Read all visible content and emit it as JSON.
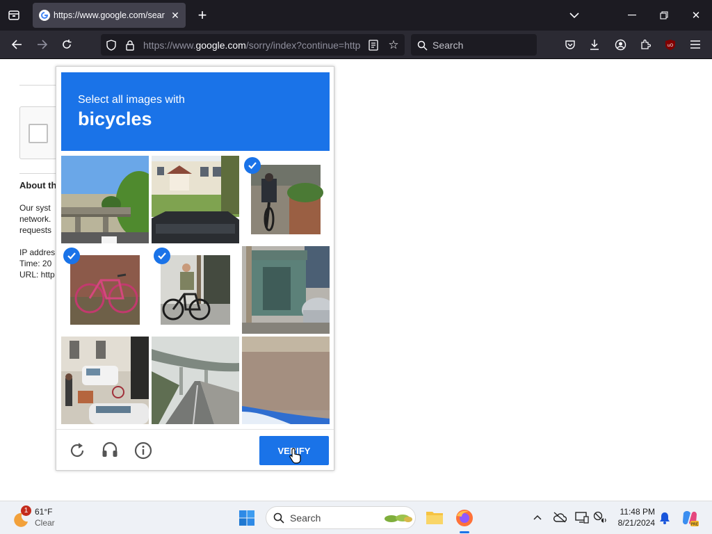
{
  "browser": {
    "tab_title": "https://www.google.com/sear",
    "url_prefix": "https://www.",
    "url_domain": "google.com",
    "url_rest": "/sorry/index?continue=http",
    "search_placeholder": "Search"
  },
  "page": {
    "about_heading": "About th",
    "body_lines": [
      "Our syst",
      "network.",
      "requests"
    ],
    "ip_label": "IP addres",
    "time_label": "Time: 20",
    "url_label": "URL: http"
  },
  "captcha": {
    "instruction": "Select all images with",
    "target": "bicycles",
    "verify_label": "VERIFY",
    "tiles": [
      {
        "scene": "overpass-bridge-trees",
        "selected": false
      },
      {
        "scene": "house-parked-car",
        "selected": false
      },
      {
        "scene": "cyclist-sidewalk",
        "selected": true
      },
      {
        "scene": "pink-bicycle",
        "selected": true
      },
      {
        "scene": "cyclist-street",
        "selected": true
      },
      {
        "scene": "bus-shelter-car",
        "selected": false
      },
      {
        "scene": "street-people-bicycle",
        "selected": false
      },
      {
        "scene": "highway-bridge",
        "selected": false
      },
      {
        "scene": "road-pavement",
        "selected": false
      }
    ]
  },
  "taskbar": {
    "weather_temp": "61°F",
    "weather_desc": "Clear",
    "weather_badge": "1",
    "search_label": "Search",
    "time": "11:48 PM",
    "date": "8/21/2024"
  },
  "colors": {
    "accent": "#1a73e8",
    "chrome_dark": "#1c1b22",
    "toolbar": "#2b2a33"
  }
}
